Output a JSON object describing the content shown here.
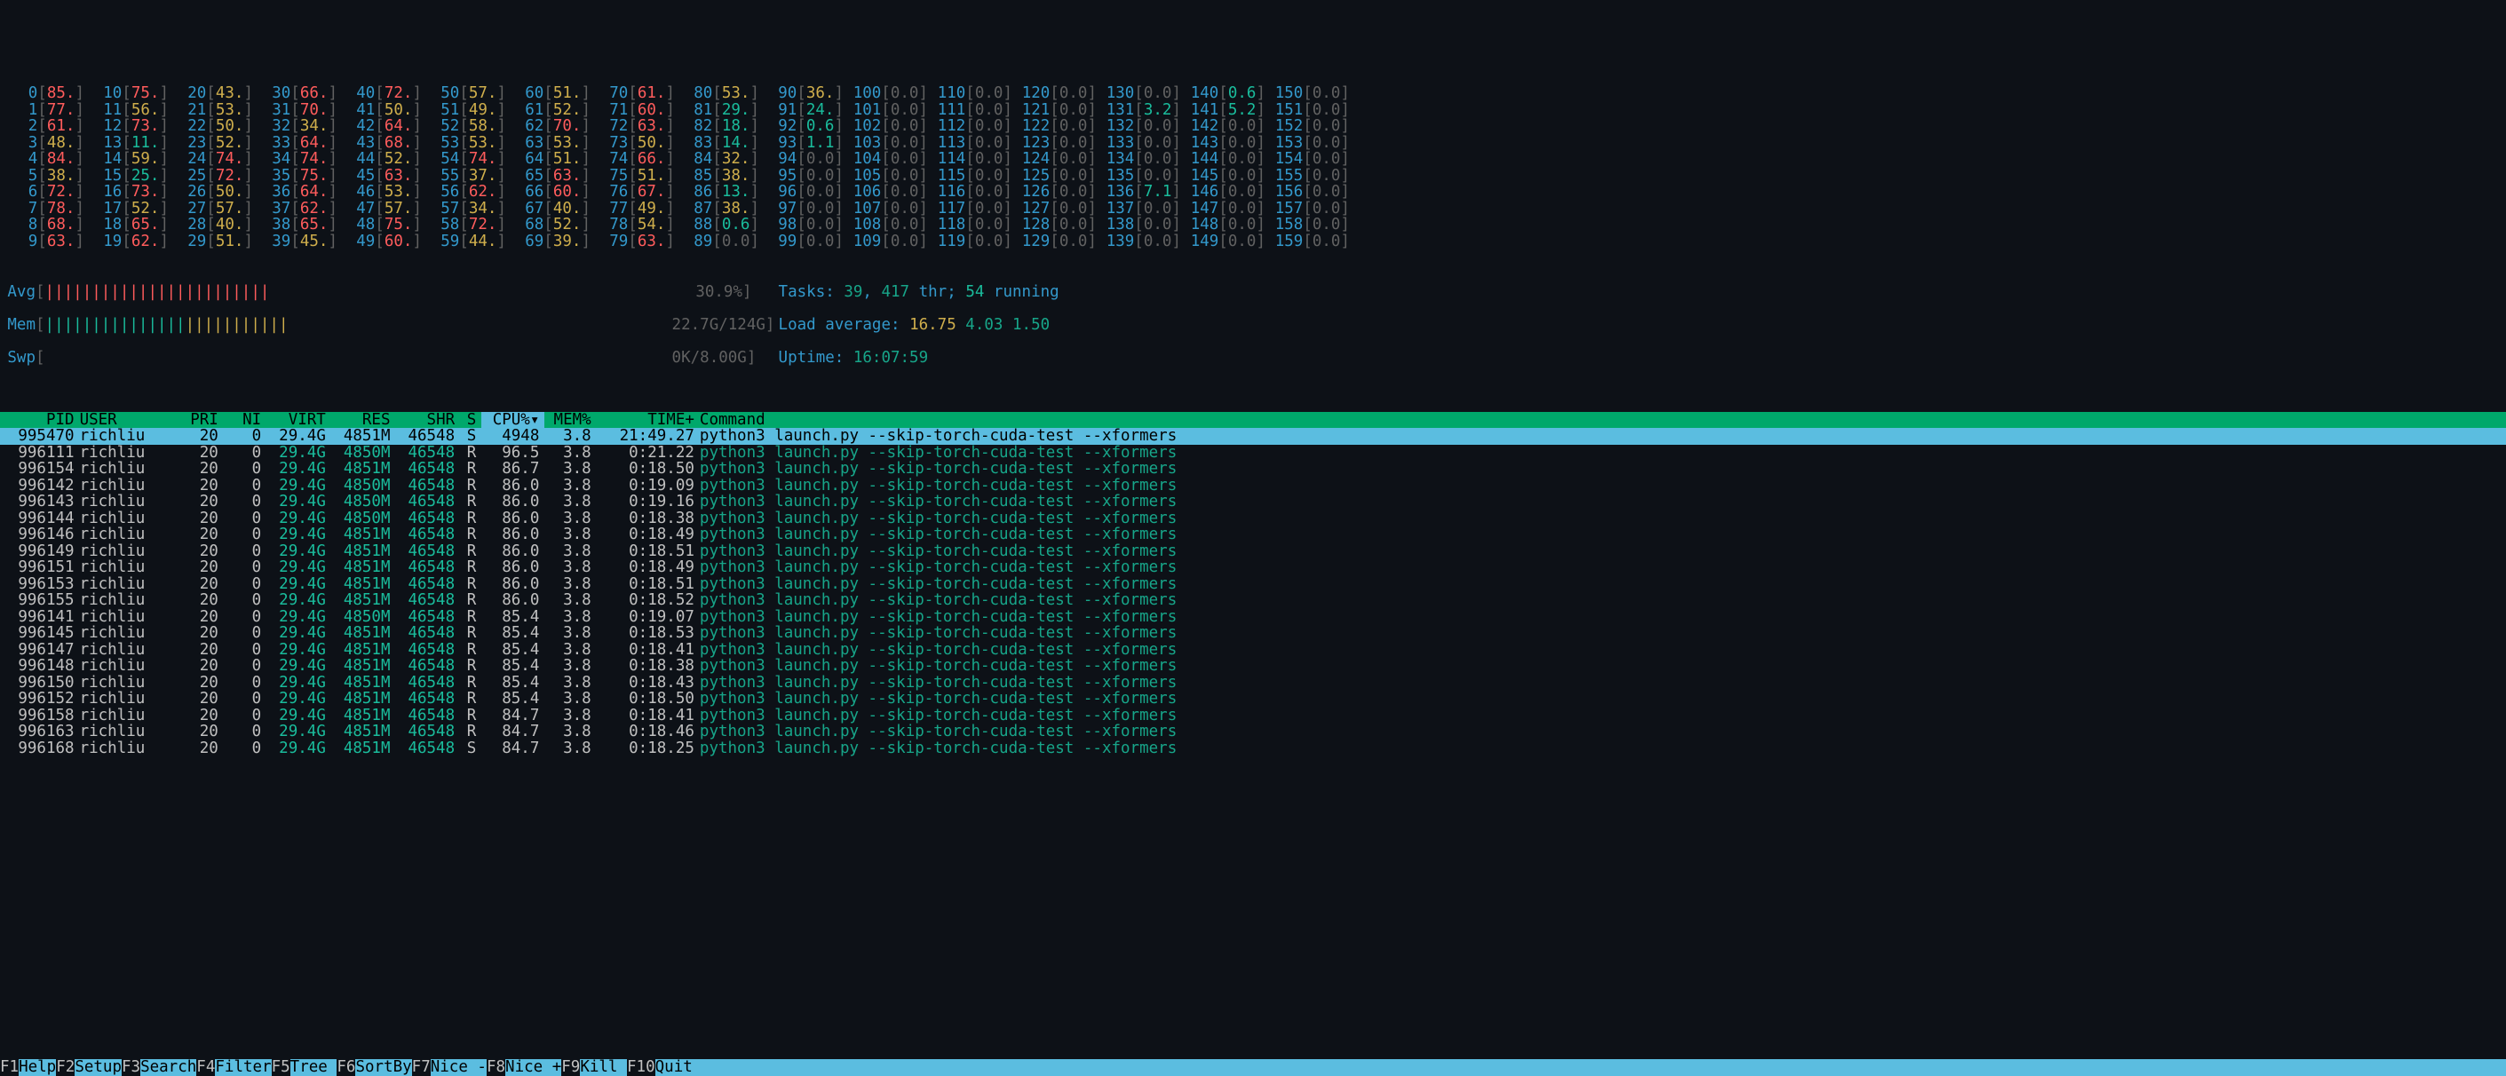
{
  "cpu_cores": [
    [
      {
        "id": 0,
        "v": "85."
      },
      {
        "id": 10,
        "v": "75."
      },
      {
        "id": 20,
        "v": "43."
      },
      {
        "id": 30,
        "v": "66."
      },
      {
        "id": 40,
        "v": "72."
      },
      {
        "id": 50,
        "v": "57."
      },
      {
        "id": 60,
        "v": "51."
      },
      {
        "id": 70,
        "v": "61."
      },
      {
        "id": 80,
        "v": "53."
      },
      {
        "id": 90,
        "v": "36."
      },
      {
        "id": 100,
        "v": "0.0"
      },
      {
        "id": 110,
        "v": "0.0"
      },
      {
        "id": 120,
        "v": "0.0"
      },
      {
        "id": 130,
        "v": "0.0"
      },
      {
        "id": 140,
        "v": "0.6"
      },
      {
        "id": 150,
        "v": "0.0"
      }
    ],
    [
      {
        "id": 1,
        "v": "77."
      },
      {
        "id": 11,
        "v": "56."
      },
      {
        "id": 21,
        "v": "53."
      },
      {
        "id": 31,
        "v": "70."
      },
      {
        "id": 41,
        "v": "50."
      },
      {
        "id": 51,
        "v": "49."
      },
      {
        "id": 61,
        "v": "52."
      },
      {
        "id": 71,
        "v": "60."
      },
      {
        "id": 81,
        "v": "29."
      },
      {
        "id": 91,
        "v": "24."
      },
      {
        "id": 101,
        "v": "0.0"
      },
      {
        "id": 111,
        "v": "0.0"
      },
      {
        "id": 121,
        "v": "0.0"
      },
      {
        "id": 131,
        "v": "3.2"
      },
      {
        "id": 141,
        "v": "5.2"
      },
      {
        "id": 151,
        "v": "0.0"
      }
    ],
    [
      {
        "id": 2,
        "v": "61."
      },
      {
        "id": 12,
        "v": "73."
      },
      {
        "id": 22,
        "v": "50."
      },
      {
        "id": 32,
        "v": "34."
      },
      {
        "id": 42,
        "v": "64."
      },
      {
        "id": 52,
        "v": "58."
      },
      {
        "id": 62,
        "v": "70."
      },
      {
        "id": 72,
        "v": "63."
      },
      {
        "id": 82,
        "v": "18."
      },
      {
        "id": 92,
        "v": "0.6"
      },
      {
        "id": 102,
        "v": "0.0"
      },
      {
        "id": 112,
        "v": "0.0"
      },
      {
        "id": 122,
        "v": "0.0"
      },
      {
        "id": 132,
        "v": "0.0"
      },
      {
        "id": 142,
        "v": "0.0"
      },
      {
        "id": 152,
        "v": "0.0"
      }
    ],
    [
      {
        "id": 3,
        "v": "48."
      },
      {
        "id": 13,
        "v": "11."
      },
      {
        "id": 23,
        "v": "52."
      },
      {
        "id": 33,
        "v": "64."
      },
      {
        "id": 43,
        "v": "68."
      },
      {
        "id": 53,
        "v": "53."
      },
      {
        "id": 63,
        "v": "53."
      },
      {
        "id": 73,
        "v": "50."
      },
      {
        "id": 83,
        "v": "14."
      },
      {
        "id": 93,
        "v": "1.1"
      },
      {
        "id": 103,
        "v": "0.0"
      },
      {
        "id": 113,
        "v": "0.0"
      },
      {
        "id": 123,
        "v": "0.0"
      },
      {
        "id": 133,
        "v": "0.0"
      },
      {
        "id": 143,
        "v": "0.0"
      },
      {
        "id": 153,
        "v": "0.0"
      }
    ],
    [
      {
        "id": 4,
        "v": "84."
      },
      {
        "id": 14,
        "v": "59."
      },
      {
        "id": 24,
        "v": "74."
      },
      {
        "id": 34,
        "v": "74."
      },
      {
        "id": 44,
        "v": "52."
      },
      {
        "id": 54,
        "v": "74."
      },
      {
        "id": 64,
        "v": "51."
      },
      {
        "id": 74,
        "v": "66."
      },
      {
        "id": 84,
        "v": "32."
      },
      {
        "id": 94,
        "v": "0.0"
      },
      {
        "id": 104,
        "v": "0.0"
      },
      {
        "id": 114,
        "v": "0.0"
      },
      {
        "id": 124,
        "v": "0.0"
      },
      {
        "id": 134,
        "v": "0.0"
      },
      {
        "id": 144,
        "v": "0.0"
      },
      {
        "id": 154,
        "v": "0.0"
      }
    ],
    [
      {
        "id": 5,
        "v": "38."
      },
      {
        "id": 15,
        "v": "25."
      },
      {
        "id": 25,
        "v": "72."
      },
      {
        "id": 35,
        "v": "75."
      },
      {
        "id": 45,
        "v": "63."
      },
      {
        "id": 55,
        "v": "37."
      },
      {
        "id": 65,
        "v": "63."
      },
      {
        "id": 75,
        "v": "51."
      },
      {
        "id": 85,
        "v": "38."
      },
      {
        "id": 95,
        "v": "0.0"
      },
      {
        "id": 105,
        "v": "0.0"
      },
      {
        "id": 115,
        "v": "0.0"
      },
      {
        "id": 125,
        "v": "0.0"
      },
      {
        "id": 135,
        "v": "0.0"
      },
      {
        "id": 145,
        "v": "0.0"
      },
      {
        "id": 155,
        "v": "0.0"
      }
    ],
    [
      {
        "id": 6,
        "v": "72."
      },
      {
        "id": 16,
        "v": "73."
      },
      {
        "id": 26,
        "v": "50."
      },
      {
        "id": 36,
        "v": "64."
      },
      {
        "id": 46,
        "v": "53."
      },
      {
        "id": 56,
        "v": "62."
      },
      {
        "id": 66,
        "v": "60."
      },
      {
        "id": 76,
        "v": "67."
      },
      {
        "id": 86,
        "v": "13."
      },
      {
        "id": 96,
        "v": "0.0"
      },
      {
        "id": 106,
        "v": "0.0"
      },
      {
        "id": 116,
        "v": "0.0"
      },
      {
        "id": 126,
        "v": "0.0"
      },
      {
        "id": 136,
        "v": "7.1"
      },
      {
        "id": 146,
        "v": "0.0"
      },
      {
        "id": 156,
        "v": "0.0"
      }
    ],
    [
      {
        "id": 7,
        "v": "78."
      },
      {
        "id": 17,
        "v": "52."
      },
      {
        "id": 27,
        "v": "57."
      },
      {
        "id": 37,
        "v": "62."
      },
      {
        "id": 47,
        "v": "57."
      },
      {
        "id": 57,
        "v": "34."
      },
      {
        "id": 67,
        "v": "40."
      },
      {
        "id": 77,
        "v": "49."
      },
      {
        "id": 87,
        "v": "38."
      },
      {
        "id": 97,
        "v": "0.0"
      },
      {
        "id": 107,
        "v": "0.0"
      },
      {
        "id": 117,
        "v": "0.0"
      },
      {
        "id": 127,
        "v": "0.0"
      },
      {
        "id": 137,
        "v": "0.0"
      },
      {
        "id": 147,
        "v": "0.0"
      },
      {
        "id": 157,
        "v": "0.0"
      }
    ],
    [
      {
        "id": 8,
        "v": "68."
      },
      {
        "id": 18,
        "v": "65."
      },
      {
        "id": 28,
        "v": "40."
      },
      {
        "id": 38,
        "v": "65."
      },
      {
        "id": 48,
        "v": "75."
      },
      {
        "id": 58,
        "v": "72."
      },
      {
        "id": 68,
        "v": "52."
      },
      {
        "id": 78,
        "v": "54."
      },
      {
        "id": 88,
        "v": "0.6"
      },
      {
        "id": 98,
        "v": "0.0"
      },
      {
        "id": 108,
        "v": "0.0"
      },
      {
        "id": 118,
        "v": "0.0"
      },
      {
        "id": 128,
        "v": "0.0"
      },
      {
        "id": 138,
        "v": "0.0"
      },
      {
        "id": 148,
        "v": "0.0"
      },
      {
        "id": 158,
        "v": "0.0"
      }
    ],
    [
      {
        "id": 9,
        "v": "63."
      },
      {
        "id": 19,
        "v": "62."
      },
      {
        "id": 29,
        "v": "51."
      },
      {
        "id": 39,
        "v": "45."
      },
      {
        "id": 49,
        "v": "60."
      },
      {
        "id": 59,
        "v": "44."
      },
      {
        "id": 69,
        "v": "39."
      },
      {
        "id": 79,
        "v": "63."
      },
      {
        "id": 89,
        "v": "0.0"
      },
      {
        "id": 99,
        "v": "0.0"
      },
      {
        "id": 109,
        "v": "0.0"
      },
      {
        "id": 119,
        "v": "0.0"
      },
      {
        "id": 129,
        "v": "0.0"
      },
      {
        "id": 139,
        "v": "0.0"
      },
      {
        "id": 149,
        "v": "0.0"
      },
      {
        "id": 159,
        "v": "0.0"
      }
    ]
  ],
  "bars": {
    "avg": {
      "label": "Avg",
      "pct": "30.9%]",
      "fill": "||||||||||||||||||||||||"
    },
    "mem": {
      "label": "Mem",
      "pct": "22.7G/124G]",
      "fill_g": "|||||||||||||||",
      "fill_y": "|||||||||||"
    },
    "swp": {
      "label": "Swp",
      "pct": "0K/8.00G]"
    }
  },
  "meta": {
    "tasks_label": "Tasks: ",
    "tasks_n": "39",
    "thr_sep": ", ",
    "thr_n": "417",
    "thr_label": " thr",
    "run_sep": "; ",
    "run_n": "54",
    "run_label": " running",
    "la_label": "Load average: ",
    "la1": "16.75",
    "la5": "4.03",
    "la15": "1.50",
    "uptime_label": "Uptime: ",
    "uptime": "16:07:59"
  },
  "header": {
    "pid": "PID",
    "user": "USER",
    "pri": "PRI",
    "ni": "NI",
    "virt": "VIRT",
    "res": "RES",
    "shr": "SHR",
    "s": "S",
    "cpu": "CPU%▾",
    "mem": "MEM%",
    "time": "TIME+",
    "cmd": "Command"
  },
  "rows": [
    {
      "pid": "995470",
      "user": "richliu",
      "pri": "20",
      "ni": "0",
      "virt": "29.4G",
      "res": "4851M",
      "shr": "46548",
      "s": "S",
      "cpu": "4948",
      "mem": "3.8",
      "time": "21:49.27",
      "cmd": "python3 launch.py --skip-torch-cuda-test --xformers",
      "sel": true
    },
    {
      "pid": "996111",
      "user": "richliu",
      "pri": "20",
      "ni": "0",
      "virt": "29.4G",
      "res": "4850M",
      "shr": "46548",
      "s": "R",
      "cpu": "96.5",
      "mem": "3.8",
      "time": "0:21.22",
      "cmd": "python3 launch.py --skip-torch-cuda-test --xformers"
    },
    {
      "pid": "996154",
      "user": "richliu",
      "pri": "20",
      "ni": "0",
      "virt": "29.4G",
      "res": "4851M",
      "shr": "46548",
      "s": "R",
      "cpu": "86.7",
      "mem": "3.8",
      "time": "0:18.50",
      "cmd": "python3 launch.py --skip-torch-cuda-test --xformers"
    },
    {
      "pid": "996142",
      "user": "richliu",
      "pri": "20",
      "ni": "0",
      "virt": "29.4G",
      "res": "4850M",
      "shr": "46548",
      "s": "R",
      "cpu": "86.0",
      "mem": "3.8",
      "time": "0:19.09",
      "cmd": "python3 launch.py --skip-torch-cuda-test --xformers"
    },
    {
      "pid": "996143",
      "user": "richliu",
      "pri": "20",
      "ni": "0",
      "virt": "29.4G",
      "res": "4850M",
      "shr": "46548",
      "s": "R",
      "cpu": "86.0",
      "mem": "3.8",
      "time": "0:19.16",
      "cmd": "python3 launch.py --skip-torch-cuda-test --xformers"
    },
    {
      "pid": "996144",
      "user": "richliu",
      "pri": "20",
      "ni": "0",
      "virt": "29.4G",
      "res": "4850M",
      "shr": "46548",
      "s": "R",
      "cpu": "86.0",
      "mem": "3.8",
      "time": "0:18.38",
      "cmd": "python3 launch.py --skip-torch-cuda-test --xformers"
    },
    {
      "pid": "996146",
      "user": "richliu",
      "pri": "20",
      "ni": "0",
      "virt": "29.4G",
      "res": "4851M",
      "shr": "46548",
      "s": "R",
      "cpu": "86.0",
      "mem": "3.8",
      "time": "0:18.49",
      "cmd": "python3 launch.py --skip-torch-cuda-test --xformers"
    },
    {
      "pid": "996149",
      "user": "richliu",
      "pri": "20",
      "ni": "0",
      "virt": "29.4G",
      "res": "4851M",
      "shr": "46548",
      "s": "R",
      "cpu": "86.0",
      "mem": "3.8",
      "time": "0:18.51",
      "cmd": "python3 launch.py --skip-torch-cuda-test --xformers"
    },
    {
      "pid": "996151",
      "user": "richliu",
      "pri": "20",
      "ni": "0",
      "virt": "29.4G",
      "res": "4851M",
      "shr": "46548",
      "s": "R",
      "cpu": "86.0",
      "mem": "3.8",
      "time": "0:18.49",
      "cmd": "python3 launch.py --skip-torch-cuda-test --xformers"
    },
    {
      "pid": "996153",
      "user": "richliu",
      "pri": "20",
      "ni": "0",
      "virt": "29.4G",
      "res": "4851M",
      "shr": "46548",
      "s": "R",
      "cpu": "86.0",
      "mem": "3.8",
      "time": "0:18.51",
      "cmd": "python3 launch.py --skip-torch-cuda-test --xformers"
    },
    {
      "pid": "996155",
      "user": "richliu",
      "pri": "20",
      "ni": "0",
      "virt": "29.4G",
      "res": "4851M",
      "shr": "46548",
      "s": "R",
      "cpu": "86.0",
      "mem": "3.8",
      "time": "0:18.52",
      "cmd": "python3 launch.py --skip-torch-cuda-test --xformers"
    },
    {
      "pid": "996141",
      "user": "richliu",
      "pri": "20",
      "ni": "0",
      "virt": "29.4G",
      "res": "4850M",
      "shr": "46548",
      "s": "R",
      "cpu": "85.4",
      "mem": "3.8",
      "time": "0:19.07",
      "cmd": "python3 launch.py --skip-torch-cuda-test --xformers"
    },
    {
      "pid": "996145",
      "user": "richliu",
      "pri": "20",
      "ni": "0",
      "virt": "29.4G",
      "res": "4851M",
      "shr": "46548",
      "s": "R",
      "cpu": "85.4",
      "mem": "3.8",
      "time": "0:18.53",
      "cmd": "python3 launch.py --skip-torch-cuda-test --xformers"
    },
    {
      "pid": "996147",
      "user": "richliu",
      "pri": "20",
      "ni": "0",
      "virt": "29.4G",
      "res": "4851M",
      "shr": "46548",
      "s": "R",
      "cpu": "85.4",
      "mem": "3.8",
      "time": "0:18.41",
      "cmd": "python3 launch.py --skip-torch-cuda-test --xformers"
    },
    {
      "pid": "996148",
      "user": "richliu",
      "pri": "20",
      "ni": "0",
      "virt": "29.4G",
      "res": "4851M",
      "shr": "46548",
      "s": "R",
      "cpu": "85.4",
      "mem": "3.8",
      "time": "0:18.38",
      "cmd": "python3 launch.py --skip-torch-cuda-test --xformers"
    },
    {
      "pid": "996150",
      "user": "richliu",
      "pri": "20",
      "ni": "0",
      "virt": "29.4G",
      "res": "4851M",
      "shr": "46548",
      "s": "R",
      "cpu": "85.4",
      "mem": "3.8",
      "time": "0:18.43",
      "cmd": "python3 launch.py --skip-torch-cuda-test --xformers"
    },
    {
      "pid": "996152",
      "user": "richliu",
      "pri": "20",
      "ni": "0",
      "virt": "29.4G",
      "res": "4851M",
      "shr": "46548",
      "s": "R",
      "cpu": "85.4",
      "mem": "3.8",
      "time": "0:18.50",
      "cmd": "python3 launch.py --skip-torch-cuda-test --xformers"
    },
    {
      "pid": "996158",
      "user": "richliu",
      "pri": "20",
      "ni": "0",
      "virt": "29.4G",
      "res": "4851M",
      "shr": "46548",
      "s": "R",
      "cpu": "84.7",
      "mem": "3.8",
      "time": "0:18.41",
      "cmd": "python3 launch.py --skip-torch-cuda-test --xformers"
    },
    {
      "pid": "996163",
      "user": "richliu",
      "pri": "20",
      "ni": "0",
      "virt": "29.4G",
      "res": "4851M",
      "shr": "46548",
      "s": "R",
      "cpu": "84.7",
      "mem": "3.8",
      "time": "0:18.46",
      "cmd": "python3 launch.py --skip-torch-cuda-test --xformers"
    },
    {
      "pid": "996168",
      "user": "richliu",
      "pri": "20",
      "ni": "0",
      "virt": "29.4G",
      "res": "4851M",
      "shr": "46548",
      "s": "S",
      "cpu": "84.7",
      "mem": "3.8",
      "time": "0:18.25",
      "cmd": "python3 launch.py --skip-torch-cuda-test --xformers"
    }
  ],
  "fkeys": [
    {
      "k": "F1",
      "l": "Help"
    },
    {
      "k": "F2",
      "l": "Setup"
    },
    {
      "k": "F3",
      "l": "Search"
    },
    {
      "k": "F4",
      "l": "Filter"
    },
    {
      "k": "F5",
      "l": "Tree "
    },
    {
      "k": "F6",
      "l": "SortBy"
    },
    {
      "k": "F7",
      "l": "Nice -"
    },
    {
      "k": "F8",
      "l": "Nice +"
    },
    {
      "k": "F9",
      "l": "Kill "
    },
    {
      "k": "F10",
      "l": "Quit"
    }
  ]
}
